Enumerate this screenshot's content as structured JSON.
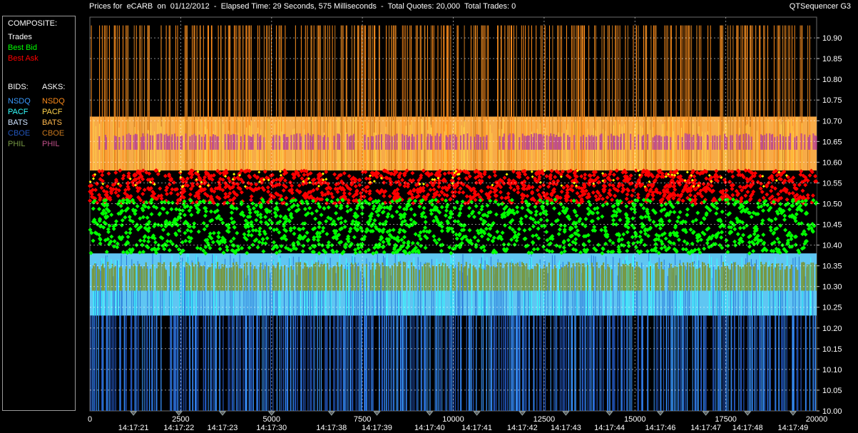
{
  "header": {
    "title": "Prices for  eCARB  on  01/12/2012  -  Elapsed Time: 29 Seconds, 575 Milliseconds  -  Total Quotes: 20,000  Total Trades: 0",
    "app_name": "QTSequencer G3"
  },
  "legend": {
    "composite_heading": "COMPOSITE:",
    "composite_items": [
      {
        "label": "Trades",
        "color": "#ffffff"
      },
      {
        "label": "Best Bid",
        "color": "#00ff00"
      },
      {
        "label": "Best Ask",
        "color": "#ff0000"
      }
    ],
    "bids_heading": "BIDS:",
    "asks_heading": "ASKS:",
    "bids": [
      {
        "label": "NSDQ",
        "color": "#3a9bff"
      },
      {
        "label": "PACF",
        "color": "#33ffff"
      },
      {
        "label": "BATS",
        "color": "#cfe3ff"
      },
      {
        "label": "CBOE",
        "color": "#2255bb"
      },
      {
        "label": "PHIL",
        "color": "#779944"
      }
    ],
    "asks": [
      {
        "label": "NSDQ",
        "color": "#ff8c1a"
      },
      {
        "label": "PACF",
        "color": "#ffd24a"
      },
      {
        "label": "BATS",
        "color": "#ffb84d"
      },
      {
        "label": "CBOE",
        "color": "#c8781e"
      },
      {
        "label": "PHIL",
        "color": "#c0508a"
      }
    ]
  },
  "chart_data": {
    "type": "line",
    "title": "",
    "xlabel": "",
    "ylabel": "",
    "xlim": [
      0,
      20000
    ],
    "ylim": [
      10.0,
      10.95
    ],
    "grid": true,
    "x_ticks": [
      "0",
      "2500",
      "5000",
      "7500",
      "10000",
      "12500",
      "15000",
      "17500",
      "20000"
    ],
    "x_tick_values": [
      0,
      2500,
      5000,
      7500,
      10000,
      12500,
      15000,
      17500,
      20000
    ],
    "time_labels": [
      {
        "x": 1200,
        "label": "14:17:21"
      },
      {
        "x": 2450,
        "label": "14:17:22"
      },
      {
        "x": 3650,
        "label": "14:17:23"
      },
      {
        "x": 5000,
        "label": "14:17:30"
      },
      {
        "x": 6650,
        "label": "14:17:38"
      },
      {
        "x": 7900,
        "label": "14:17:39"
      },
      {
        "x": 9350,
        "label": "14:17:40"
      },
      {
        "x": 10650,
        "label": "14:17:41"
      },
      {
        "x": 11900,
        "label": "14:17:42"
      },
      {
        "x": 13100,
        "label": "14:17:43"
      },
      {
        "x": 14300,
        "label": "14:17:44"
      },
      {
        "x": 15700,
        "label": "14:17:46"
      },
      {
        "x": 16950,
        "label": "14:17:47"
      },
      {
        "x": 18100,
        "label": "14:17:48"
      },
      {
        "x": 19350,
        "label": "14:17:49"
      }
    ],
    "y_ticks": [
      "10.00",
      "10.05",
      "10.10",
      "10.15",
      "10.20",
      "10.25",
      "10.30",
      "10.35",
      "10.40",
      "10.45",
      "10.50",
      "10.55",
      "10.60",
      "10.65",
      "10.70",
      "10.75",
      "10.80",
      "10.85",
      "10.90"
    ],
    "y_tick_values": [
      10.0,
      10.05,
      10.1,
      10.15,
      10.2,
      10.25,
      10.3,
      10.35,
      10.4,
      10.45,
      10.5,
      10.55,
      10.6,
      10.65,
      10.7,
      10.75,
      10.8,
      10.85,
      10.9
    ],
    "series": [
      {
        "name": "NSDQ",
        "side": "ask",
        "color": "#ff8c1a",
        "typical_range": [
          10.6,
          10.93
        ]
      },
      {
        "name": "PACF",
        "side": "ask",
        "color": "#ffd24a",
        "typical_range": [
          10.58,
          10.71
        ]
      },
      {
        "name": "BATS",
        "side": "ask",
        "color": "#ffb84d",
        "typical_range": [
          10.58,
          10.71
        ]
      },
      {
        "name": "CBOE",
        "side": "ask",
        "color": "#c8781e",
        "typical_range": [
          10.6,
          10.93
        ]
      },
      {
        "name": "PHIL",
        "side": "ask",
        "color": "#c0508a",
        "typical_range": [
          10.63,
          10.67
        ]
      },
      {
        "name": "Best Ask",
        "side": "composite",
        "color": "#ff0000",
        "typical_range": [
          10.5,
          10.58
        ]
      },
      {
        "name": "Best Bid",
        "side": "composite",
        "color": "#00ff00",
        "typical_range": [
          10.38,
          10.51
        ]
      },
      {
        "name": "NSDQ",
        "side": "bid",
        "color": "#3a9bff",
        "typical_range": [
          10.0,
          10.38
        ]
      },
      {
        "name": "PACF",
        "side": "bid",
        "color": "#33ffff",
        "typical_range": [
          10.23,
          10.38
        ]
      },
      {
        "name": "BATS",
        "side": "bid",
        "color": "#cfe3ff",
        "typical_range": [
          10.23,
          10.38
        ]
      },
      {
        "name": "CBOE",
        "side": "bid",
        "color": "#2255bb",
        "typical_range": [
          10.0,
          10.23
        ]
      },
      {
        "name": "PHIL",
        "side": "bid",
        "color": "#779944",
        "typical_range": [
          10.29,
          10.36
        ]
      }
    ]
  }
}
